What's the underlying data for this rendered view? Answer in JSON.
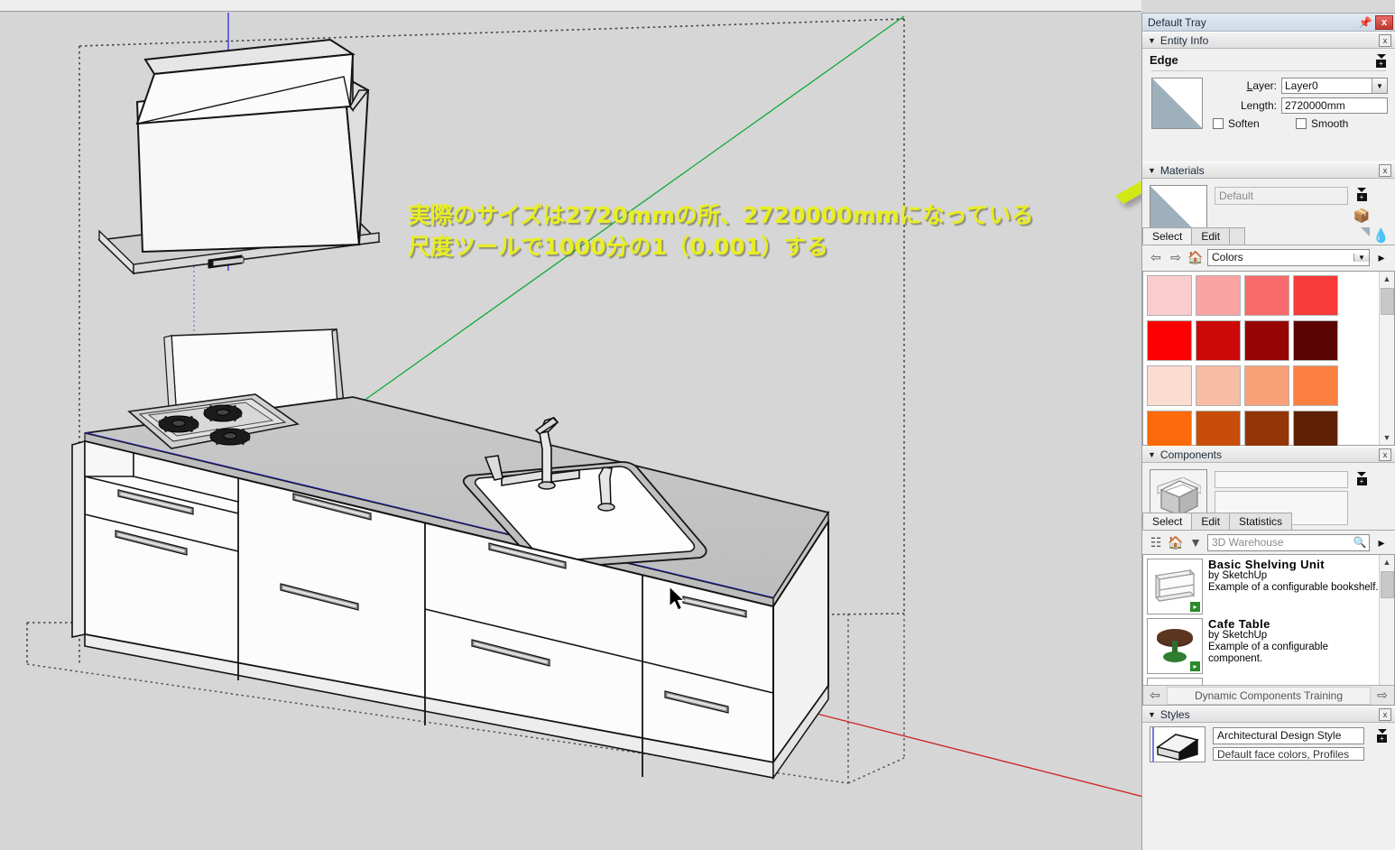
{
  "tray": {
    "title": "Default Tray",
    "pin_icon": "pin-icon",
    "close_label": "x"
  },
  "entity_info": {
    "header": "Entity Info",
    "close_label": "x",
    "entity_type": "Edge",
    "layer_label": "Layer:",
    "layer_value": "Layer0",
    "length_label": "Length:",
    "length_value": "2720000mm",
    "soften_label": "Soften",
    "smooth_label": "Smooth"
  },
  "materials": {
    "header": "Materials",
    "close_label": "x",
    "material_name": "Default",
    "tabs": [
      "Select",
      "Edit"
    ],
    "active_tab": "Select",
    "library": "Colors",
    "back_icon": "left-arrow-icon",
    "forward_icon": "right-arrow-icon",
    "home_icon": "home-icon",
    "details_icon": "details-arrow-icon",
    "eyedropper_icon": "eyedropper-icon",
    "bucket_icon": "paint-bucket-icon",
    "swatches": [
      "#f9cdcd",
      "#f9a3a3",
      "#f96a6a",
      "#f73a3a",
      "#fb0000",
      "#cd0808",
      "#960404",
      "#5c0303",
      "#fadcd0",
      "#f9bca5",
      "#f9a179",
      "#fb8040",
      "#fb6a0b",
      "#c74d08",
      "#933506",
      "#5e2103"
    ]
  },
  "components": {
    "header": "Components",
    "close_label": "x",
    "tabs": [
      "Select",
      "Edit",
      "Statistics"
    ],
    "active_tab": "Select",
    "search_placeholder": "3D Warehouse",
    "search_icon": "magnifier-icon",
    "home_icon": "home-icon",
    "grid_icon": "view-options-icon",
    "thumb_icon": "component-cube-icon",
    "items": [
      {
        "name": "Basic Shelving Unit",
        "author": "by SketchUp",
        "description": "Example of a configurable bookshelf.",
        "thumb_icon": "shelving-unit-icon"
      },
      {
        "name": "Cafe Table",
        "author": "by SketchUp",
        "description": "Example of a configurable component.",
        "thumb_icon": "cafe-table-icon"
      }
    ],
    "collection_label": "Dynamic Components Training",
    "prev_icon": "left-arrow-icon",
    "next_icon": "right-arrow-icon"
  },
  "styles": {
    "header": "Styles",
    "close_label": "x",
    "style_name": "Architectural Design Style",
    "style_desc": "Default face colors, Profiles"
  },
  "viewport": {
    "annotation_line1": "実際のサイズは2720mmの所、2720000mmになっている",
    "annotation_line2": "尺度ツールで1000分の1（0.001）する",
    "annotation_color": "#e8ee22",
    "arrow_color": "#d2e817",
    "axis_blue": "#2222cc",
    "axis_green": "#11aa33",
    "axis_red": "#cc2222",
    "selection_color": "#2020e0",
    "background_color": "#d6d6d6",
    "cursor_icon": "arrow-cursor-icon",
    "model_name": "kitchen-counter-model"
  }
}
